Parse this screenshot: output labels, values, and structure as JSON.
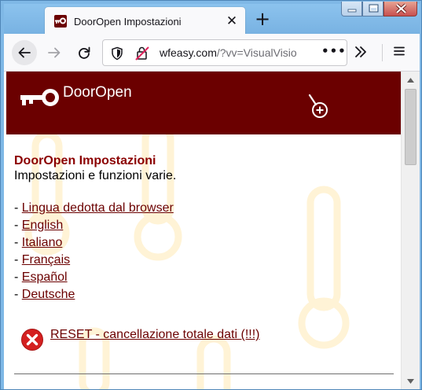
{
  "browser": {
    "tab_title": "DoorOpen Impostazioni",
    "tab_close_glyph": "✕",
    "new_tab_glyph": "+",
    "url_host": "wfeasy.com",
    "url_rest": "/?vv=VisualVisio",
    "url_more_glyph": "•••",
    "icons": {
      "favicon": "key-icon",
      "back": "back-arrow-icon",
      "forward": "forward-arrow-icon",
      "reload": "reload-icon",
      "shield": "shield-icon",
      "tracking": "tracking-blocked-icon",
      "overflow": "chevron-double-right-icon",
      "menu": "hamburger-menu-icon"
    }
  },
  "site": {
    "brand": "DoorOpen",
    "header_color": "#6b0000",
    "accent_color": "#8b0000"
  },
  "page": {
    "title": "DoorOpen Impostazioni",
    "subtitle": "Impostazioni e funzioni varie.",
    "languages": [
      "Lingua dedotta dal browser",
      "English",
      "Italiano",
      "Français",
      "Español",
      "Deutsche"
    ],
    "reset_label": "RESET - cancellazione totale dati (!!!)",
    "reset_icon_color": "#d42020"
  }
}
